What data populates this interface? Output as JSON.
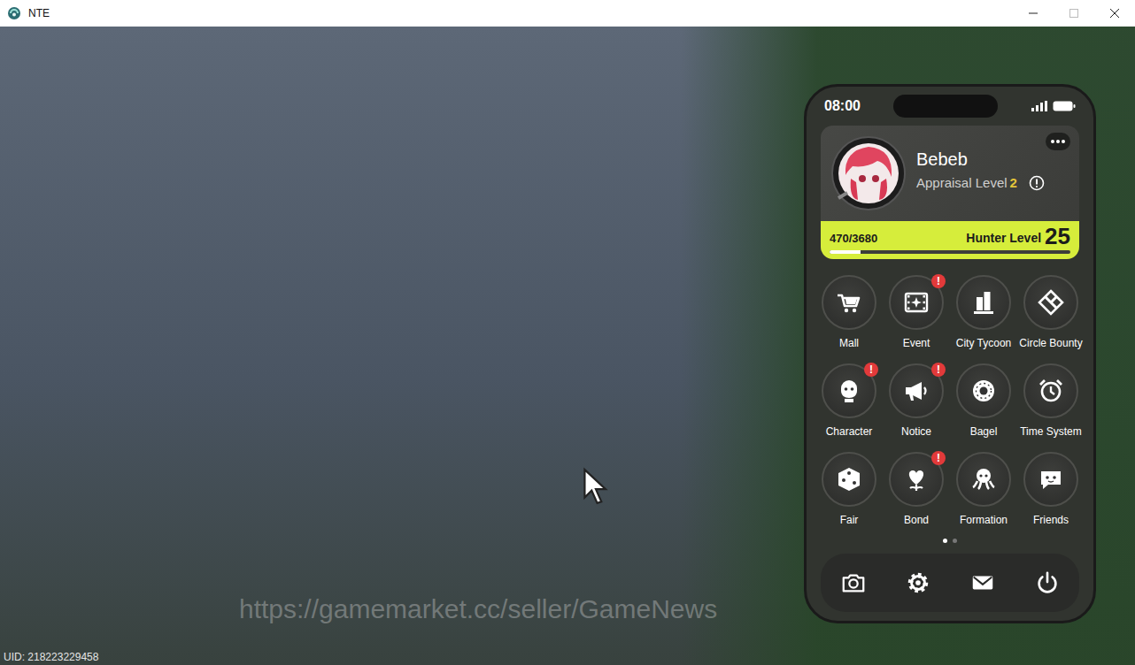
{
  "window": {
    "title": "NTE"
  },
  "game": {
    "uid": "UID: 218223229458",
    "watermark": "https://gamemarket.cc/seller/GameNews"
  },
  "phone": {
    "time": "08:00",
    "profile": {
      "name": "Bebeb",
      "appraisal_label": "Appraisal Level",
      "appraisal_level": "2",
      "xp": "470/3680",
      "hunter_label": "Hunter Level",
      "hunter_level": "25",
      "level": 0.128
    },
    "badge_glyph": "!",
    "apps": [
      {
        "label": "Mall",
        "badge": false
      },
      {
        "label": "Event",
        "badge": true
      },
      {
        "label": "City Tycoon",
        "badge": false
      },
      {
        "label": "Circle Bounty",
        "badge": false
      },
      {
        "label": "Character",
        "badge": true
      },
      {
        "label": "Notice",
        "badge": true
      },
      {
        "label": "Bagel",
        "badge": false
      },
      {
        "label": "Time System",
        "badge": false
      },
      {
        "label": "Fair",
        "badge": false
      },
      {
        "label": "Bond",
        "badge": true
      },
      {
        "label": "Formation",
        "badge": false
      },
      {
        "label": "Friends",
        "badge": false
      }
    ],
    "pages": [
      {
        "selected": true
      },
      {
        "selected": false
      }
    ]
  }
}
